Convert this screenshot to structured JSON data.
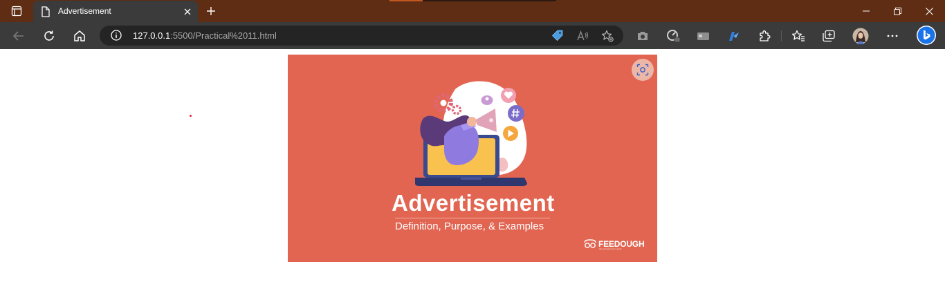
{
  "browser": {
    "tab_title": "Advertisement",
    "address": {
      "host": "127.0.0.1",
      "rest": ":5500/Practical%2011.html"
    }
  },
  "icons": {
    "tab_actions": "tab-actions-icon",
    "page": "page-icon",
    "close_tab": "close-icon",
    "new_tab": "plus-icon",
    "minimize": "minimize-icon",
    "restore": "restore-icon",
    "close_window": "close-icon",
    "back": "back-arrow-icon",
    "refresh": "refresh-icon",
    "home": "home-icon",
    "site_info": "info-icon",
    "shopping": "tag-icon",
    "read_aloud": "read-aloud-icon",
    "add_favorite": "star-plus-icon",
    "screenshot": "camera-icon",
    "extension1": "performance-icon",
    "extension2": "wallet-icon",
    "extension3": "pen-icon",
    "extensions": "puzzle-icon",
    "favorites": "favorites-icon",
    "collections": "collections-icon",
    "profile": "avatar",
    "menu": "more-icon",
    "copilot": "bing-icon",
    "visual_search": "visual-search-icon"
  },
  "colors": {
    "titlebar": "#5e2d13",
    "toolbar": "#3b3b3b",
    "omnibox": "#242424",
    "ad_background": "#e26552",
    "bing": "#1a73e8"
  },
  "ad": {
    "title": "Advertisement",
    "subtitle": "Definition, Purpose, & Examples",
    "brand": "FEEDOUGH",
    "brand_tagline": "the entrepreneurs' guide"
  }
}
